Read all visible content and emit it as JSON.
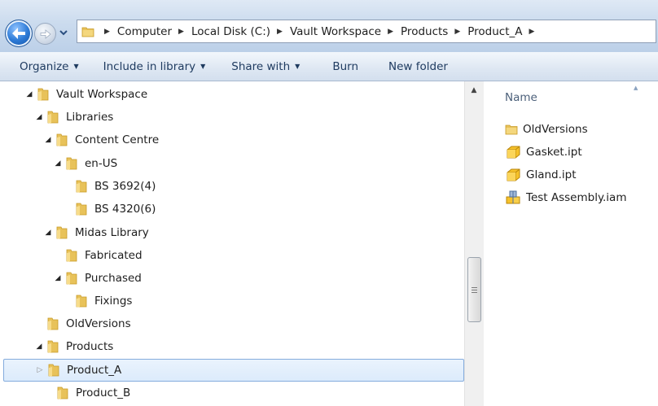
{
  "breadcrumb": {
    "items": [
      "Computer",
      "Local Disk (C:)",
      "Vault Workspace",
      "Products",
      "Product_A"
    ]
  },
  "toolbar": {
    "organize": "Organize",
    "include_in_library": "Include in library",
    "share_with": "Share with",
    "burn": "Burn",
    "new_folder": "New folder"
  },
  "tree": {
    "items": [
      {
        "label": "Vault Workspace",
        "expand": "expanded"
      },
      {
        "label": "Libraries",
        "expand": "expanded"
      },
      {
        "label": "Content Centre",
        "expand": "expanded"
      },
      {
        "label": "en-US",
        "expand": "expanded"
      },
      {
        "label": "BS 3692(4)",
        "expand": "none"
      },
      {
        "label": "BS 4320(6)",
        "expand": "none"
      },
      {
        "label": "Midas Library",
        "expand": "expanded"
      },
      {
        "label": "Fabricated",
        "expand": "none"
      },
      {
        "label": "Purchased",
        "expand": "expanded"
      },
      {
        "label": "Fixings",
        "expand": "none"
      },
      {
        "label": "OldVersions",
        "expand": "none"
      },
      {
        "label": "Products",
        "expand": "expanded"
      },
      {
        "label": "Product_A",
        "expand": "collapsed",
        "selected": true
      },
      {
        "label": "Product_B",
        "expand": "none"
      }
    ]
  },
  "file_list": {
    "column_header": "Name",
    "items": [
      {
        "name": "OldVersions",
        "icon": "folder-icon"
      },
      {
        "name": "Gasket.ipt",
        "icon": "part-file-icon"
      },
      {
        "name": "Gland.ipt",
        "icon": "part-file-icon"
      },
      {
        "name": "Test Assembly.iam",
        "icon": "assembly-file-icon"
      }
    ]
  },
  "colors": {
    "selection_border": "#84acdd",
    "folder": "#e8c25a"
  }
}
